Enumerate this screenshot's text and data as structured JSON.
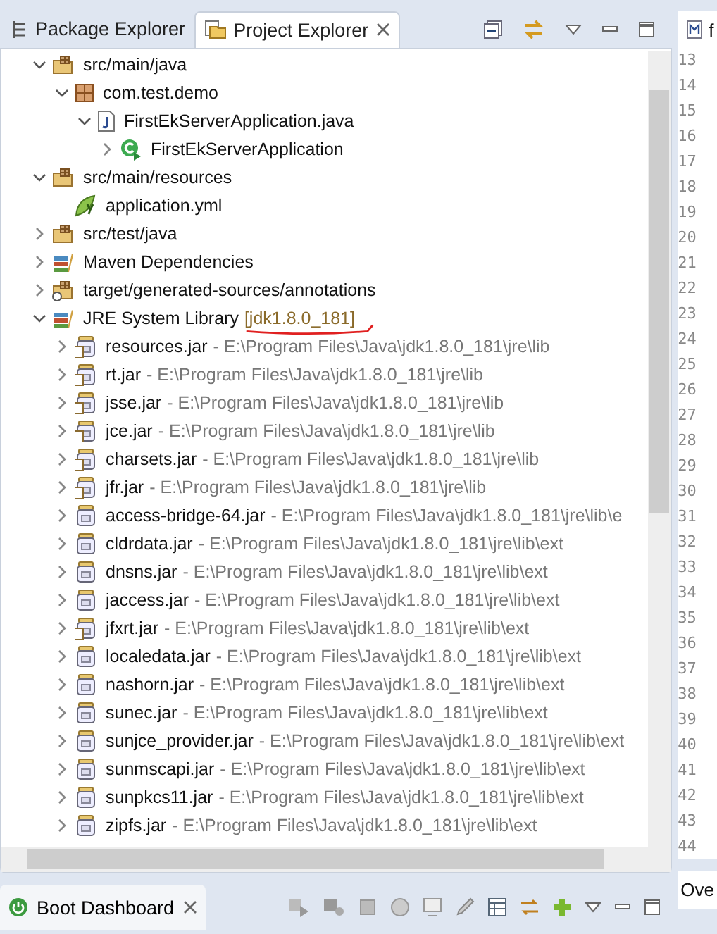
{
  "explorer": {
    "tabs": [
      {
        "label": "Package Explorer",
        "selected": false
      },
      {
        "label": "Project Explorer",
        "selected": true
      }
    ],
    "tree": [
      {
        "kind": "source-folder",
        "label": "src/main/java",
        "expanded": true,
        "children": [
          {
            "kind": "package",
            "label": "com.test.demo",
            "expanded": true,
            "children": [
              {
                "kind": "java-file",
                "label": "FirstEkServerApplication.java",
                "expanded": true,
                "children": [
                  {
                    "kind": "class",
                    "label": "FirstEkServerApplication",
                    "expanded": false
                  }
                ]
              }
            ]
          }
        ]
      },
      {
        "kind": "source-folder",
        "label": "src/main/resources",
        "expanded": true,
        "children": [
          {
            "kind": "yml",
            "label": "application.yml"
          }
        ]
      },
      {
        "kind": "source-folder",
        "label": "src/test/java",
        "expanded": false
      },
      {
        "kind": "library",
        "label": "Maven Dependencies",
        "expanded": false
      },
      {
        "kind": "generated-folder",
        "label": "target/generated-sources/annotations",
        "expanded": false
      },
      {
        "kind": "library",
        "label": "JRE System Library",
        "decoration": "[jdk1.8.0_181]",
        "annotated": true,
        "expanded": true,
        "children": [
          {
            "kind": "jar-attached",
            "label": "resources.jar",
            "path": "- E:\\Program Files\\Java\\jdk1.8.0_181\\jre\\lib",
            "expanded": false
          },
          {
            "kind": "jar-attached",
            "label": "rt.jar",
            "path": "- E:\\Program Files\\Java\\jdk1.8.0_181\\jre\\lib",
            "expanded": false
          },
          {
            "kind": "jar-attached",
            "label": "jsse.jar",
            "path": "- E:\\Program Files\\Java\\jdk1.8.0_181\\jre\\lib",
            "expanded": false
          },
          {
            "kind": "jar-attached",
            "label": "jce.jar",
            "path": "- E:\\Program Files\\Java\\jdk1.8.0_181\\jre\\lib",
            "expanded": false
          },
          {
            "kind": "jar-attached",
            "label": "charsets.jar",
            "path": "- E:\\Program Files\\Java\\jdk1.8.0_181\\jre\\lib",
            "expanded": false
          },
          {
            "kind": "jar-attached",
            "label": "jfr.jar",
            "path": "- E:\\Program Files\\Java\\jdk1.8.0_181\\jre\\lib",
            "expanded": false
          },
          {
            "kind": "jar",
            "label": "access-bridge-64.jar",
            "path": "- E:\\Program Files\\Java\\jdk1.8.0_181\\jre\\lib\\e",
            "expanded": false
          },
          {
            "kind": "jar",
            "label": "cldrdata.jar",
            "path": "- E:\\Program Files\\Java\\jdk1.8.0_181\\jre\\lib\\ext",
            "expanded": false
          },
          {
            "kind": "jar",
            "label": "dnsns.jar",
            "path": "- E:\\Program Files\\Java\\jdk1.8.0_181\\jre\\lib\\ext",
            "expanded": false
          },
          {
            "kind": "jar",
            "label": "jaccess.jar",
            "path": "- E:\\Program Files\\Java\\jdk1.8.0_181\\jre\\lib\\ext",
            "expanded": false
          },
          {
            "kind": "jar-attached",
            "label": "jfxrt.jar",
            "path": "- E:\\Program Files\\Java\\jdk1.8.0_181\\jre\\lib\\ext",
            "expanded": false
          },
          {
            "kind": "jar",
            "label": "localedata.jar",
            "path": "- E:\\Program Files\\Java\\jdk1.8.0_181\\jre\\lib\\ext",
            "expanded": false
          },
          {
            "kind": "jar",
            "label": "nashorn.jar",
            "path": "- E:\\Program Files\\Java\\jdk1.8.0_181\\jre\\lib\\ext",
            "expanded": false
          },
          {
            "kind": "jar",
            "label": "sunec.jar",
            "path": "- E:\\Program Files\\Java\\jdk1.8.0_181\\jre\\lib\\ext",
            "expanded": false
          },
          {
            "kind": "jar",
            "label": "sunjce_provider.jar",
            "path": "- E:\\Program Files\\Java\\jdk1.8.0_181\\jre\\lib\\ext",
            "expanded": false
          },
          {
            "kind": "jar",
            "label": "sunmscapi.jar",
            "path": "- E:\\Program Files\\Java\\jdk1.8.0_181\\jre\\lib\\ext",
            "expanded": false
          },
          {
            "kind": "jar",
            "label": "sunpkcs11.jar",
            "path": "- E:\\Program Files\\Java\\jdk1.8.0_181\\jre\\lib\\ext",
            "expanded": false
          },
          {
            "kind": "jar",
            "label": "zipfs.jar",
            "path": "- E:\\Program Files\\Java\\jdk1.8.0_181\\jre\\lib\\ext",
            "expanded": false
          }
        ]
      }
    ]
  },
  "editor": {
    "tab": "f",
    "line_numbers": [
      "13",
      "14",
      "15",
      "16",
      "17",
      "18",
      "19",
      "20",
      "21",
      "22",
      "23",
      "24",
      "25",
      "26",
      "27",
      "28",
      "29",
      "30",
      "31",
      "32",
      "33",
      "34",
      "35",
      "36",
      "37",
      "38",
      "39",
      "40",
      "41",
      "42",
      "43",
      "44"
    ]
  },
  "bottom_panel": {
    "tab": {
      "label": "Boot Dashboard",
      "selected": true
    }
  },
  "side_panel": {
    "tab": "Ove"
  }
}
